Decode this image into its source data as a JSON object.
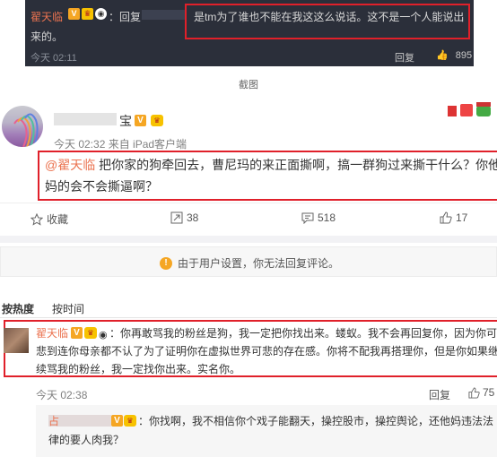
{
  "top_screenshot": {
    "user_name": "翟天临",
    "reply_prefix": "：回复",
    "highlighted_text_line1": "是tm为了谁也不能在我这这么说话。这不是一个人能说出",
    "highlighted_text_line2": "来的。",
    "time": "今天 02:11",
    "reply_label": "回复",
    "like_count": "895"
  },
  "caption": "截图",
  "post": {
    "author_suffix": "宝",
    "meta": "今天 02:32 来自 iPad客户端",
    "mention": "@翟天临",
    "text": " 把你家的狗牵回去，曹尼玛的来正面撕啊，搞一群狗过来撕干什么？你他妈的会不会撕逼啊？",
    "actions": {
      "favorite_label": "收藏",
      "repost_count": "38",
      "comment_count": "518",
      "like_count": "17"
    }
  },
  "notice": "由于用户设置，你无法回复评论。",
  "sort_tabs": [
    "按热度",
    "按时间"
  ],
  "comments": [
    {
      "user_name": "翟天临",
      "text": "：你再敢骂我的粉丝是狗，我一定把你找出来。蝼蚁。我不会再回复你，因为你可悲到连你母亲都不认了为了证明你在虚拟世界可悲的存在感。你将不配我再搭理你，但是你如果继续骂我的粉丝，我一定找你出来。实名你。",
      "time": "今天 02:38",
      "reply_label": "回复",
      "like_count": "75"
    },
    {
      "user_name": "占",
      "text": "：你找啊，我不相信你个戏子能翻天，操控股市，操控舆论，还他妈违法法律的要人肉我？"
    }
  ],
  "colors": {
    "highlight_box": "#e0202a",
    "user_name": "#eb7350",
    "dark_bg": "#2b2f3a"
  }
}
